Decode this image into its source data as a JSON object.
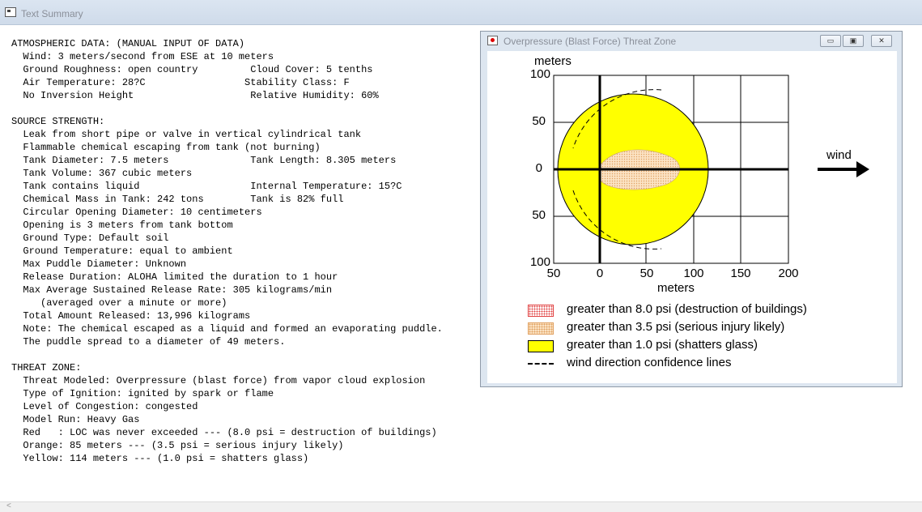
{
  "window": {
    "title": "Text Summary"
  },
  "report_lines": [
    "ATMOSPHERIC DATA: (MANUAL INPUT OF DATA)",
    "  Wind: 3 meters/second from ESE at 10 meters",
    "  Ground Roughness: open country         Cloud Cover: 5 tenths",
    "  Air Temperature: 28?C                 Stability Class: F",
    "  No Inversion Height                    Relative Humidity: 60%",
    "",
    "SOURCE STRENGTH:",
    "  Leak from short pipe or valve in vertical cylindrical tank",
    "  Flammable chemical escaping from tank (not burning)",
    "  Tank Diameter: 7.5 meters              Tank Length: 8.305 meters",
    "  Tank Volume: 367 cubic meters",
    "  Tank contains liquid                   Internal Temperature: 15?C",
    "  Chemical Mass in Tank: 242 tons        Tank is 82% full",
    "  Circular Opening Diameter: 10 centimeters",
    "  Opening is 3 meters from tank bottom",
    "  Ground Type: Default soil",
    "  Ground Temperature: equal to ambient",
    "  Max Puddle Diameter: Unknown",
    "  Release Duration: ALOHA limited the duration to 1 hour",
    "  Max Average Sustained Release Rate: 305 kilograms/min",
    "     (averaged over a minute or more)",
    "  Total Amount Released: 13,996 kilograms",
    "  Note: The chemical escaped as a liquid and formed an evaporating puddle.",
    "  The puddle spread to a diameter of 49 meters.",
    "",
    "THREAT ZONE:",
    "  Threat Modeled: Overpressure (blast force) from vapor cloud explosion",
    "  Type of Ignition: ignited by spark or flame",
    "  Level of Congestion: congested",
    "  Model Run: Heavy Gas",
    "  Red   : LOC was never exceeded --- (8.0 psi = destruction of buildings)",
    "  Orange: 85 meters --- (3.5 psi = serious injury likely)",
    "  Yellow: 114 meters --- (1.0 psi = shatters glass)"
  ],
  "dialog": {
    "title": "Overpressure (Blast Force) Threat Zone",
    "buttons": {
      "minimize": "▭",
      "restore": "▣",
      "close": "✕"
    }
  },
  "plot": {
    "y_unit": "meters",
    "x_unit": "meters",
    "wind_label": "wind",
    "x_ticks": [
      "50",
      "0",
      "50",
      "100",
      "150",
      "200"
    ],
    "y_ticks": [
      "100",
      "50",
      "0",
      "50",
      "100"
    ]
  },
  "legend": [
    {
      "text": "greater than 8.0 psi (destruction of buildings)"
    },
    {
      "text": "greater than 3.5 psi (serious injury likely)"
    },
    {
      "text": "greater than 1.0 psi (shatters glass)"
    },
    {
      "text": "wind direction confidence lines"
    }
  ],
  "colors": {
    "yellow_zone": "#ffff00",
    "orange_zone": "#fbe3c4",
    "red_zone": "#e04040"
  }
}
